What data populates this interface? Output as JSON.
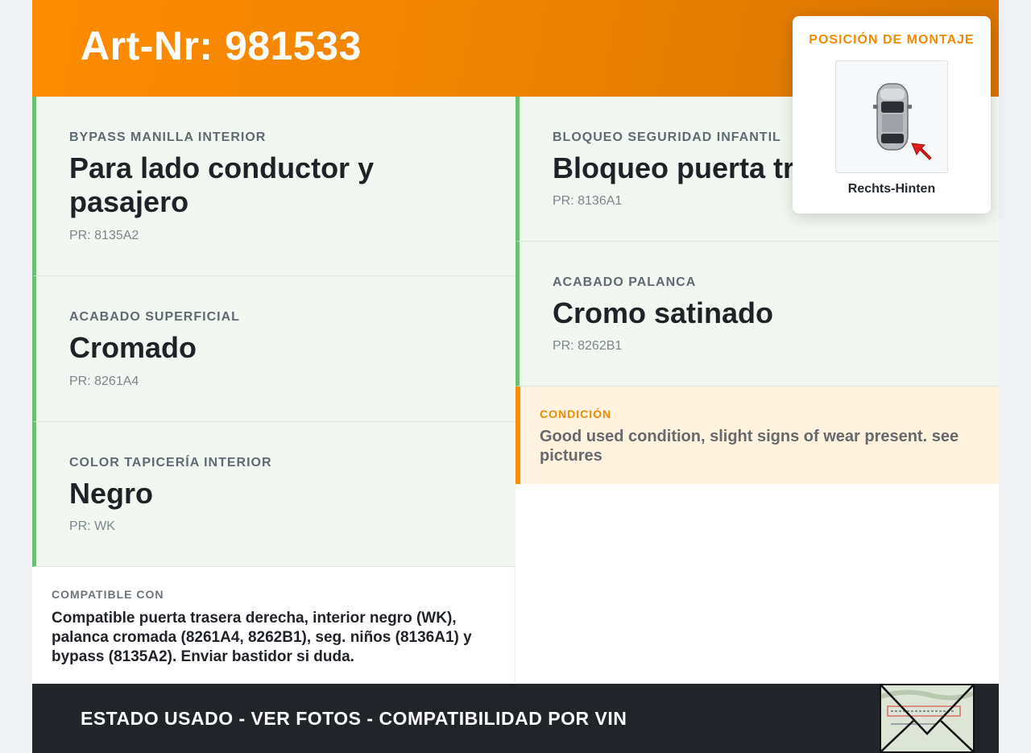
{
  "header": {
    "title": "Art-Nr: 981533"
  },
  "features_left": [
    {
      "label": "BYPASS MANILLA INTERIOR",
      "value": "Para lado conductor y pasajero",
      "pr": "PR: 8135A2"
    },
    {
      "label": "ACABADO SUPERFICIAL",
      "value": "Cromado",
      "pr": "PR: 8261A4"
    },
    {
      "label": "COLOR TAPICERÍA INTERIOR",
      "value": "Negro",
      "pr": "PR: WK"
    }
  ],
  "features_right": [
    {
      "label": "BLOQUEO SEGURIDAD INFANTIL",
      "value": "Bloqueo puerta tr",
      "pr": "PR: 8136A1"
    },
    {
      "label": "ACABADO PALANCA",
      "value": "Cromo satinado",
      "pr": "PR: 8262B1"
    }
  ],
  "condition": {
    "label": "CONDICIÓN",
    "text": "Good used condition, slight signs of wear present. see pictures"
  },
  "compatible": {
    "label": "COMPATIBLE CON",
    "text": "Compatible puerta trasera derecha, interior negro (WK), palanca cromada (8261A4, 8262B1), seg. niños (8136A1) y bypass (8135A2). Enviar bastidor si duda."
  },
  "mounting": {
    "title": "POSICIÓN DE MONTAJE",
    "position": "Rechts-Hinten"
  },
  "footer": {
    "text": "ESTADO USADO - VER FOTOS - COMPATIBILIDAD POR VIN"
  },
  "colors": {
    "accent": "#ff8c00",
    "card_border": "#6cc070",
    "card_bg": "#f2f8f1",
    "footer_bg": "#212429"
  }
}
